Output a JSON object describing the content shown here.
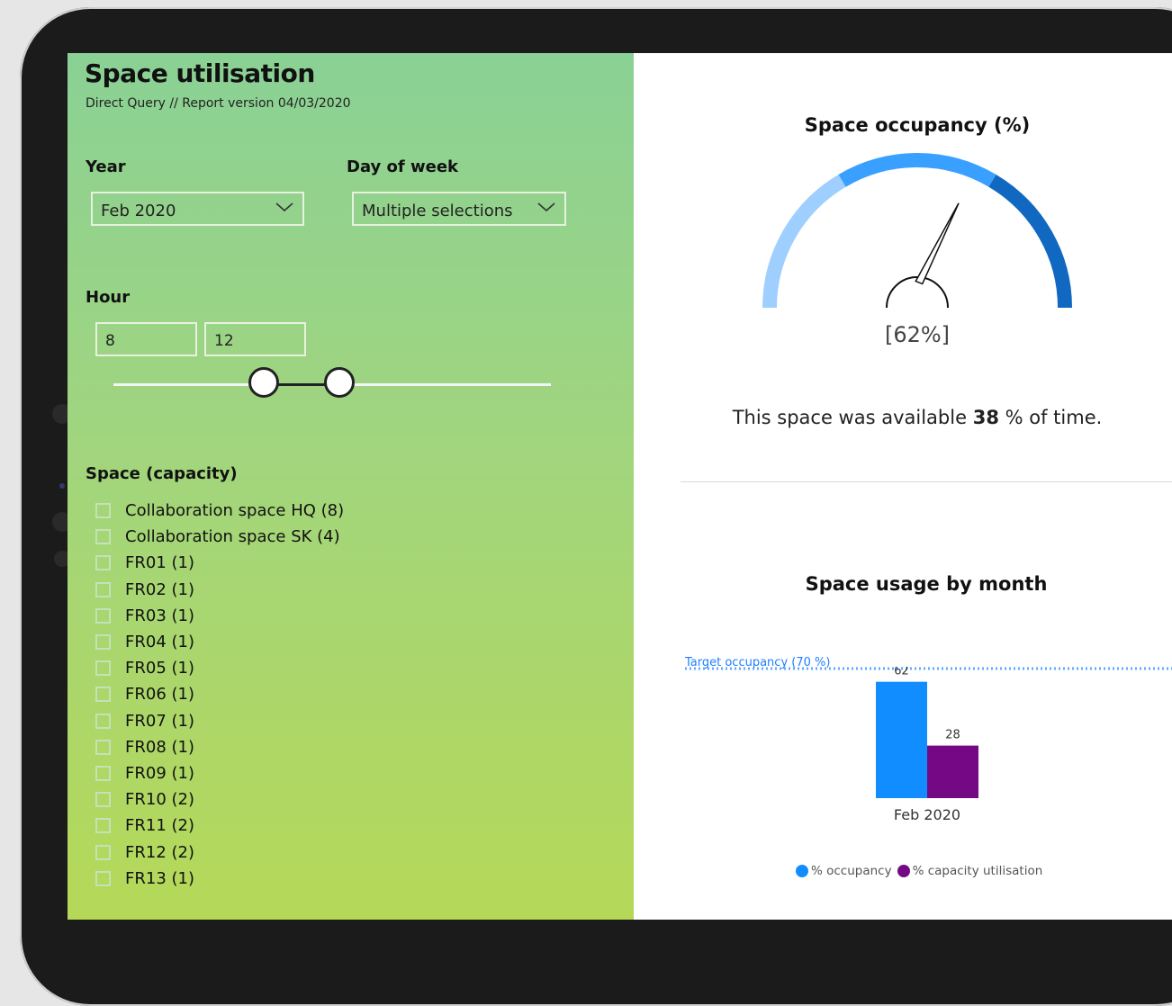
{
  "report": {
    "title": "Space utilisation",
    "subtitle": "Direct Query // Report version 04/03/2020"
  },
  "filters": {
    "year_label": "Year",
    "year_value": "Feb 2020",
    "dow_label": "Day of week",
    "dow_value": "Multiple selections",
    "hour_label": "Hour",
    "hour_from": "8",
    "hour_to": "12",
    "space_label": "Space (capacity)",
    "spaces": [
      "Collaboration space HQ (8)",
      "Collaboration space SK (4)",
      "FR01 (1)",
      "FR02 (1)",
      "FR03 (1)",
      "FR04 (1)",
      "FR05 (1)",
      "FR06 (1)",
      "FR07 (1)",
      "FR08 (1)",
      "FR09 (1)",
      "FR10 (2)",
      "FR11 (2)",
      "FR12 (2)",
      "FR13 (1)"
    ]
  },
  "gauge": {
    "title": "Space occupancy (%)",
    "value_text": "[62%]",
    "value": 62,
    "min": 0,
    "max": 100,
    "colors": [
      "#9fcfff",
      "#3aa0ff",
      "#1168c0"
    ]
  },
  "availability": {
    "prefix": "This space was available",
    "value": "38",
    "suffix": "% of time."
  },
  "icons": {
    "dropdown": "chevron-down-icon"
  },
  "chart_data": {
    "type": "bar",
    "title": "Space usage by month",
    "categories": [
      "Feb 2020"
    ],
    "series": [
      {
        "name": "% occupancy",
        "values": [
          62
        ],
        "color": "#118dff"
      },
      {
        "name": "% capacity utilisation",
        "values": [
          28
        ],
        "color": "#750985"
      }
    ],
    "reference_line": {
      "label": "Target occupancy (70 %)",
      "value": 70,
      "color": "#5ea8ff"
    },
    "ylim": [
      0,
      70
    ],
    "legend": "bottom",
    "grid": false
  }
}
